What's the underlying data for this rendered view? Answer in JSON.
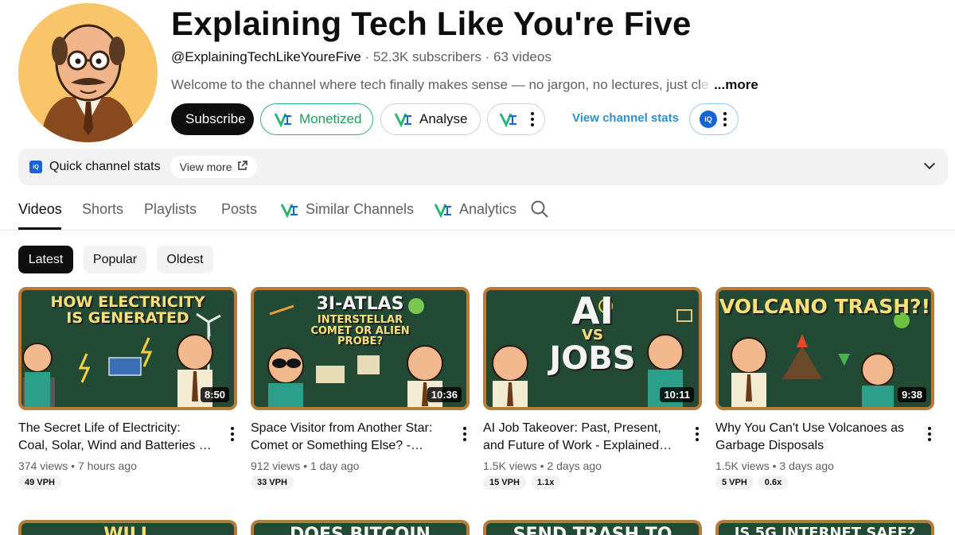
{
  "channel": {
    "title": "Explaining Tech Like You're Five",
    "handle": "@ExplainingTechLikeYoureFive",
    "subscribers": "52.3K subscribers",
    "videos_count": "63 videos",
    "description_visible": "Welcome to the channel where tech finally makes sense — no jargon, no lectures, just cl",
    "description_faded": "e",
    "more_label": "...more"
  },
  "buttons": {
    "subscribe": "Subscribe",
    "monetized": "Monetized",
    "analyse": "Analyse",
    "view_channel_stats": "View channel stats",
    "iq_label": "iQ"
  },
  "quick_stats": {
    "title": "Quick channel stats",
    "view_more": "View more",
    "iq_label": "iQ"
  },
  "tabs": [
    {
      "label": "Videos"
    },
    {
      "label": "Shorts"
    },
    {
      "label": "Playlists"
    },
    {
      "label": "Posts"
    },
    {
      "label": "Similar Channels"
    },
    {
      "label": "Analytics"
    }
  ],
  "filters": [
    {
      "label": "Latest"
    },
    {
      "label": "Popular"
    },
    {
      "label": "Oldest"
    }
  ],
  "videos": [
    {
      "thumb_text_line1": "HOW ELECTRICITY",
      "thumb_text_line2": "IS GENERATED",
      "duration": "8:50",
      "title": "The Secret Life of Electricity: Coal, Solar, Wind and Batteries - Explained Like You're Five",
      "views": "374 views",
      "age": "7 hours ago",
      "badges": [
        "49 VPH"
      ]
    },
    {
      "thumb_text_line1": "3I-ATLAS",
      "thumb_text_line2": "INTERSTELLAR COMET OR ALIEN PROBE?",
      "duration": "10:36",
      "title": "Space Visitor from Another Star: Comet or Something Else? - Explained Like You're Five",
      "views": "912 views",
      "age": "1 day ago",
      "badges": [
        "33 VPH"
      ]
    },
    {
      "thumb_text_line1": "AI",
      "thumb_text_line2": "JOBS",
      "thumb_vs": "VS",
      "duration": "10:11",
      "title": "AI Job Takeover: Past, Present, and Future of Work - Explained Like You're Five",
      "views": "1.5K views",
      "age": "2 days ago",
      "badges": [
        "15 VPH",
        "1.1x"
      ]
    },
    {
      "thumb_text_line1": "VOLCANO TRASH?!",
      "thumb_text_line2": "",
      "duration": "9:38",
      "title": "Why You Can't Use Volcanoes as Garbage Disposals",
      "views": "1.5K views",
      "age": "3 days ago",
      "badges": [
        "5 VPH",
        "0.6x"
      ]
    }
  ],
  "next_row": [
    "WILL",
    "DOES BITCOIN",
    "SEND TRASH TO",
    "IS 5G INTERNET SAFE?"
  ],
  "colors": {
    "accent_green": "#2bb673",
    "vidiq_blue": "#1665d8",
    "link_blue": "#2d8fd5",
    "chalkboard": "#234a35",
    "frame": "#b57d3a"
  }
}
